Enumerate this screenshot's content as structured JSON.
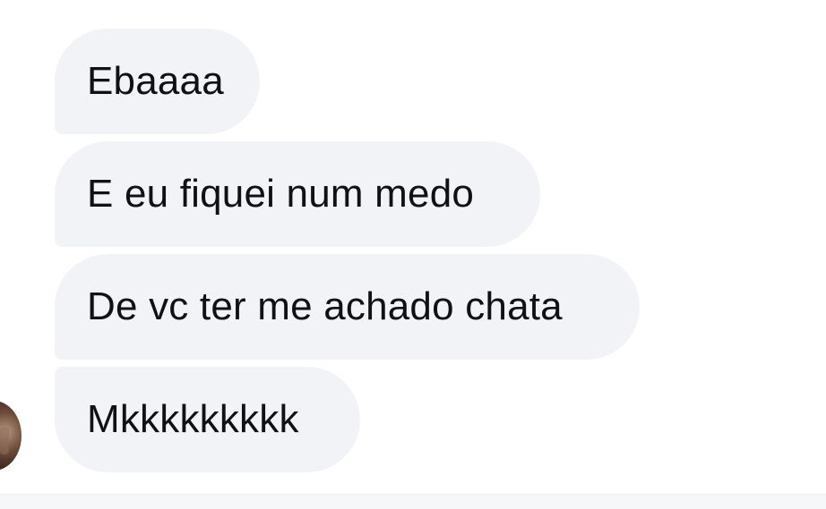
{
  "conversation": {
    "messages": [
      {
        "text": "Ebaaaa"
      },
      {
        "text": "E eu fiquei num medo"
      },
      {
        "text": "De vc ter me achado chata"
      },
      {
        "text": "Mkkkkkkkkk"
      }
    ]
  },
  "colors": {
    "background": "#ffffff",
    "bubble": "#f2f3f6",
    "text": "#101114",
    "composer": "#f6f7f9"
  }
}
